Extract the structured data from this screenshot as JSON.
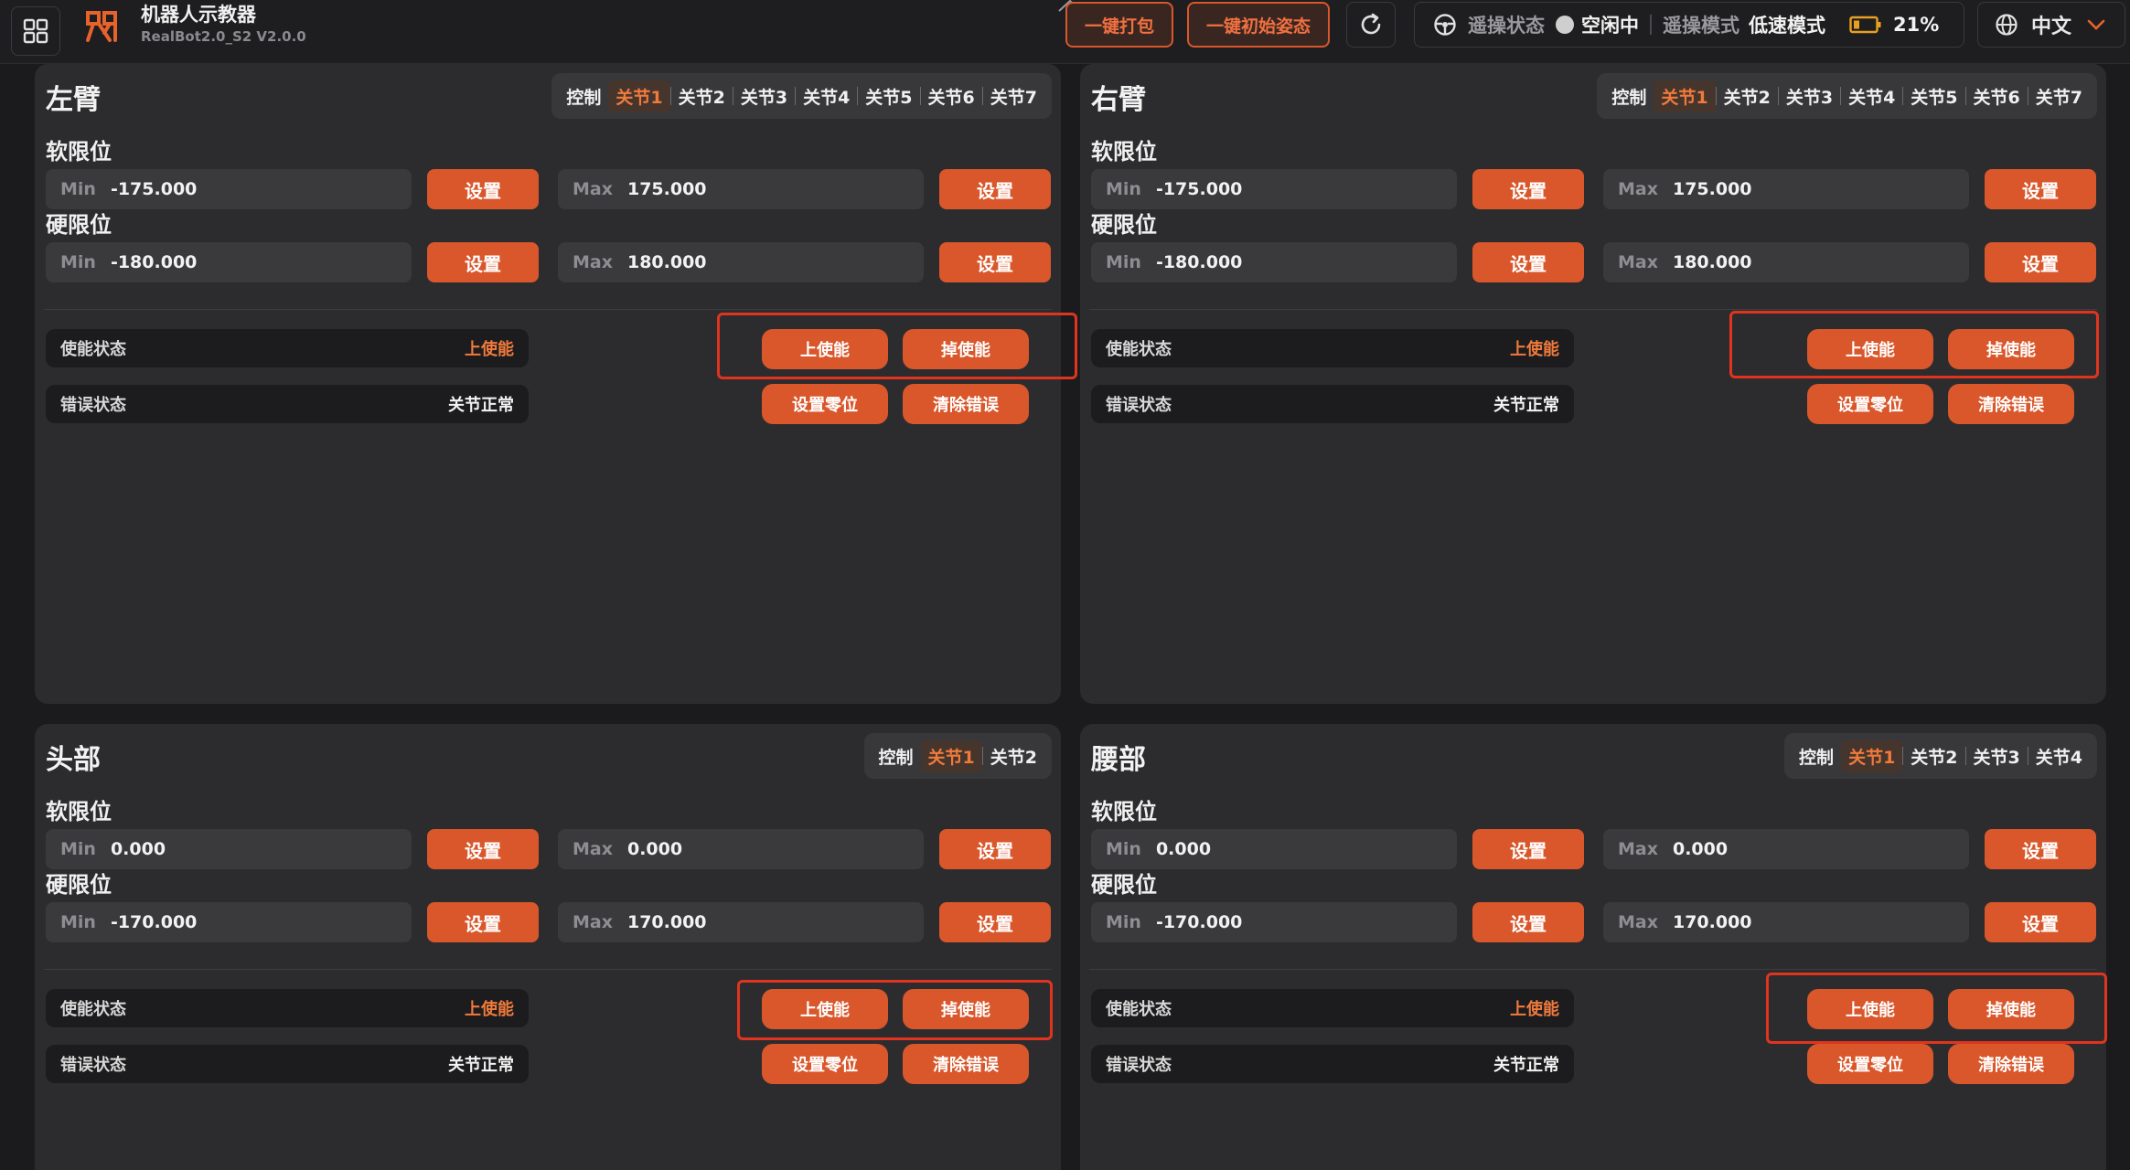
{
  "header": {
    "app_title": "机器人示教器",
    "app_version": "RealBot2.0_S2 V2.0.0",
    "btn_pack": "一键打包",
    "btn_init_pose": "一键初始姿态",
    "teleop_status_label": "遥操状态",
    "teleop_status_value": "空闲中",
    "teleop_mode_label": "遥操模式",
    "teleop_mode_value": "低速模式",
    "battery": "21%",
    "language": "中文"
  },
  "labels": {
    "soft_limit": "软限位",
    "hard_limit": "硬限位",
    "min": "Min",
    "max": "Max",
    "set": "设置",
    "enable_state": "使能状态",
    "error_state": "错误状态",
    "enable": "上使能",
    "disable": "掉使能",
    "set_zero": "设置零位",
    "clear_error": "清除错误"
  },
  "panels": [
    {
      "title": "左臂",
      "tabs": [
        "控制",
        "关节1",
        "关节2",
        "关节3",
        "关节4",
        "关节5",
        "关节6",
        "关节7"
      ],
      "active_tab": 1,
      "soft_min": "-175.000",
      "soft_max": "175.000",
      "hard_min": "-180.000",
      "hard_max": "180.000",
      "enable_state": "上使能",
      "error_state": "关节正常"
    },
    {
      "title": "右臂",
      "tabs": [
        "控制",
        "关节1",
        "关节2",
        "关节3",
        "关节4",
        "关节5",
        "关节6",
        "关节7"
      ],
      "active_tab": 1,
      "soft_min": "-175.000",
      "soft_max": "175.000",
      "hard_min": "-180.000",
      "hard_max": "180.000",
      "enable_state": "上使能",
      "error_state": "关节正常"
    },
    {
      "title": "头部",
      "tabs": [
        "控制",
        "关节1",
        "关节2"
      ],
      "active_tab": 1,
      "soft_min": "0.000",
      "soft_max": "0.000",
      "hard_min": "-170.000",
      "hard_max": "170.000",
      "enable_state": "上使能",
      "error_state": "关节正常"
    },
    {
      "title": "腰部",
      "tabs": [
        "控制",
        "关节1",
        "关节2",
        "关节3",
        "关节4"
      ],
      "active_tab": 1,
      "soft_min": "0.000",
      "soft_max": "0.000",
      "hard_min": "-170.000",
      "hard_max": "170.000",
      "enable_state": "上使能",
      "error_state": "关节正常"
    }
  ],
  "colors": {
    "accent": "#d9572b",
    "accent_text": "#f07a3c",
    "highlight": "#e0341f",
    "panel_bg": "#2c2c2f",
    "page_bg": "#1b1b1d"
  }
}
